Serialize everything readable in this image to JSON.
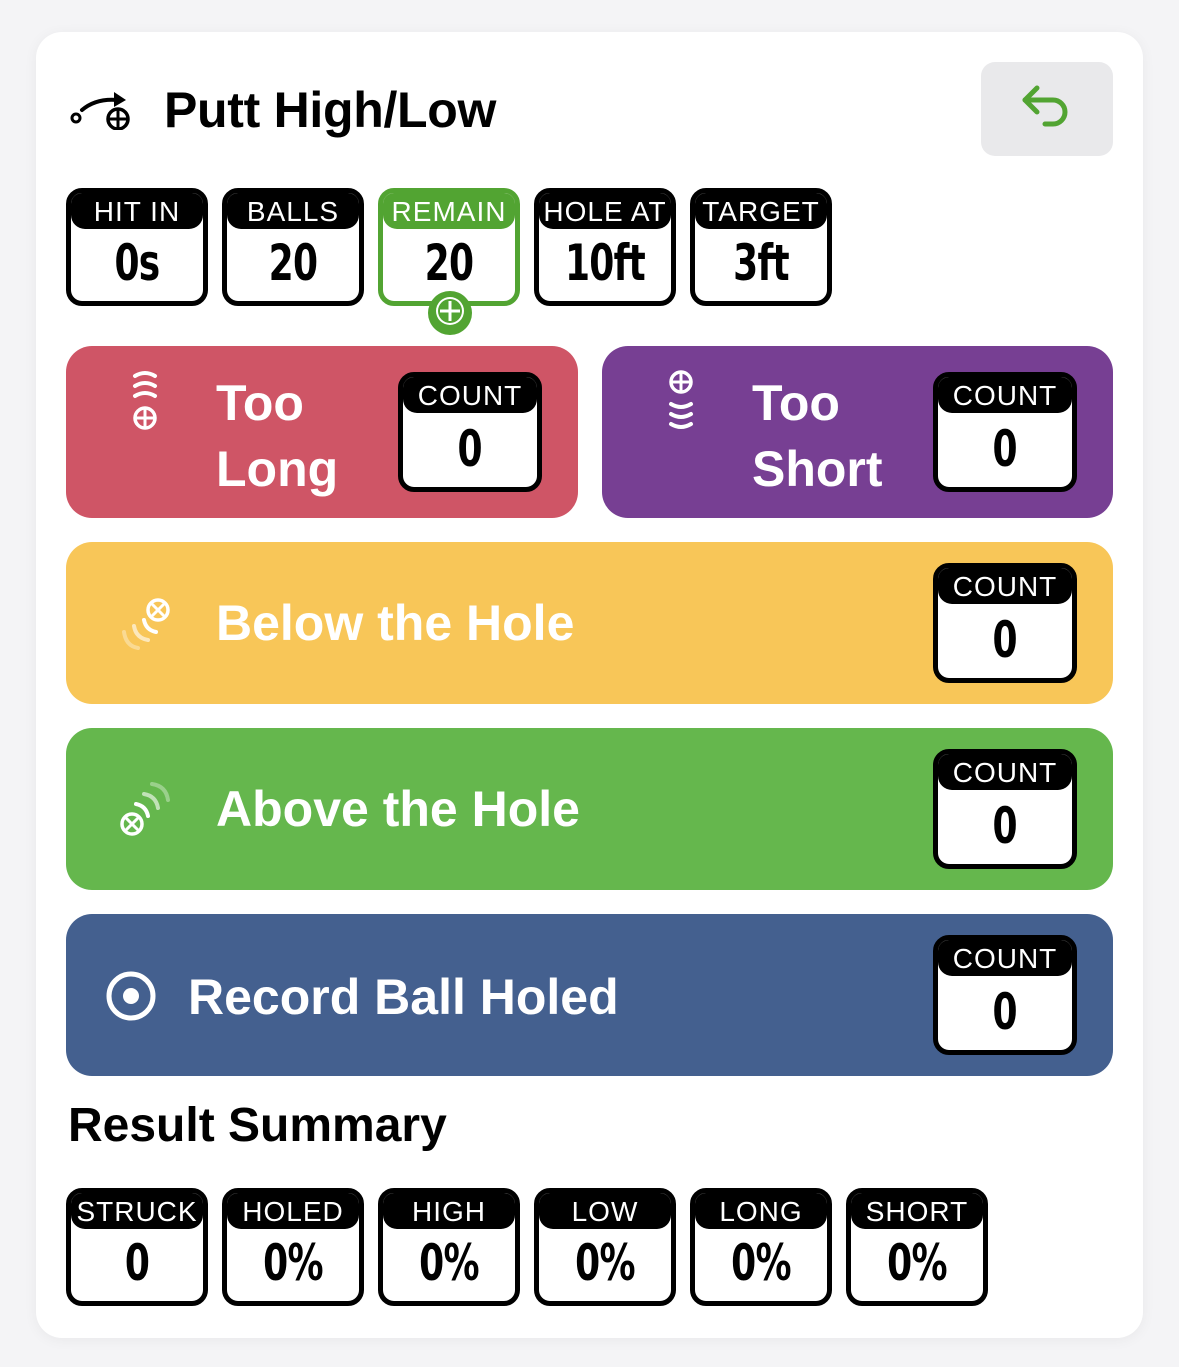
{
  "header": {
    "title": "Putt High/Low",
    "title_icon": "putt-path-icon",
    "undo_icon": "undo-arrow-icon"
  },
  "colors": {
    "accent_green": "#52a432",
    "too_long": "#cf5566",
    "too_short": "#773f93",
    "below_hole": "#f8c658",
    "above_hole": "#65b74d",
    "ball_holed": "#44608f"
  },
  "stats": [
    {
      "label": "HIT IN",
      "value": "0s"
    },
    {
      "label": "BALLS",
      "value": "20"
    },
    {
      "label": "REMAIN",
      "value": "20"
    },
    {
      "label": "HOLE AT",
      "value": "10ft"
    },
    {
      "label": "TARGET",
      "value": "3ft"
    }
  ],
  "actions": {
    "too_long": {
      "line1": "Too",
      "line2": "Long",
      "count_label": "COUNT",
      "count": "0",
      "icon": "ball-too-long-icon"
    },
    "too_short": {
      "line1": "Too",
      "line2": "Short",
      "count_label": "COUNT",
      "count": "0",
      "icon": "ball-too-short-icon"
    },
    "below_hole": {
      "label": "Below the Hole",
      "count_label": "COUNT",
      "count": "0",
      "icon": "ball-below-hole-icon"
    },
    "above_hole": {
      "label": "Above the Hole",
      "count_label": "COUNT",
      "count": "0",
      "icon": "ball-above-hole-icon"
    },
    "ball_holed": {
      "label": "Record Ball Holed",
      "count_label": "COUNT",
      "count": "0",
      "icon": "target-dot-icon"
    }
  },
  "summary": {
    "title": "Result Summary",
    "items": [
      {
        "label": "STRUCK",
        "value": "0"
      },
      {
        "label": "HOLED",
        "value": "0%"
      },
      {
        "label": "HIGH",
        "value": "0%"
      },
      {
        "label": "LOW",
        "value": "0%"
      },
      {
        "label": "LONG",
        "value": "0%"
      },
      {
        "label": "SHORT",
        "value": "0%"
      }
    ]
  }
}
